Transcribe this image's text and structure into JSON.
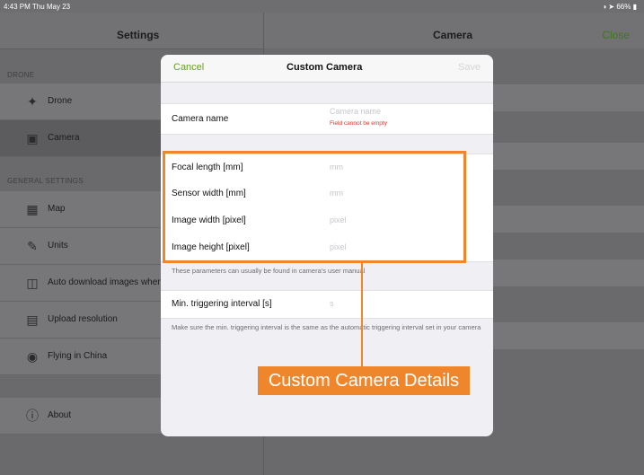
{
  "status_bar": {
    "time": "4:43 PM  Thu May 23",
    "battery": "66%"
  },
  "settings": {
    "title": "Settings",
    "drone_section": "DRONE",
    "general_section": "GENERAL SETTINGS",
    "items": [
      {
        "label": "Drone",
        "icon": "drone-icon"
      },
      {
        "label": "Camera",
        "icon": "camera-icon",
        "selected": true
      },
      {
        "label": "Map",
        "icon": "map-icon"
      },
      {
        "label": "Units",
        "icon": "ruler-icon"
      },
      {
        "label": "Auto download images when",
        "icon": "download-images-icon"
      },
      {
        "label": "Upload resolution",
        "icon": "upload-resolution-icon"
      },
      {
        "label": "Flying in China",
        "icon": "china-icon"
      },
      {
        "label": "About",
        "icon": "info-icon"
      }
    ]
  },
  "camera_pane": {
    "title": "Camera",
    "close_label": "Close"
  },
  "modal": {
    "cancel": "Cancel",
    "title": "Custom Camera",
    "save": "Save",
    "camera_name_label": "Camera name",
    "camera_name_placeholder": "Camera name",
    "camera_name_error": "Field cannot be empty",
    "fields": [
      {
        "label": "Focal length [mm]",
        "placeholder": "mm"
      },
      {
        "label": "Sensor width [mm]",
        "placeholder": "mm"
      },
      {
        "label": "Image width [pixel]",
        "placeholder": "pixel"
      },
      {
        "label": "Image height [pixel]",
        "placeholder": "pixel"
      }
    ],
    "fields_note": "These parameters can usually be found in camera's user manual",
    "trigger_label": "Min. triggering interval [s]",
    "trigger_placeholder": "s",
    "trigger_note": "Make sure the min. triggering interval is the same as the automatic triggering interval set in your camera"
  },
  "annotation": {
    "callout": "Custom Camera Details",
    "color": "#f0862b"
  }
}
